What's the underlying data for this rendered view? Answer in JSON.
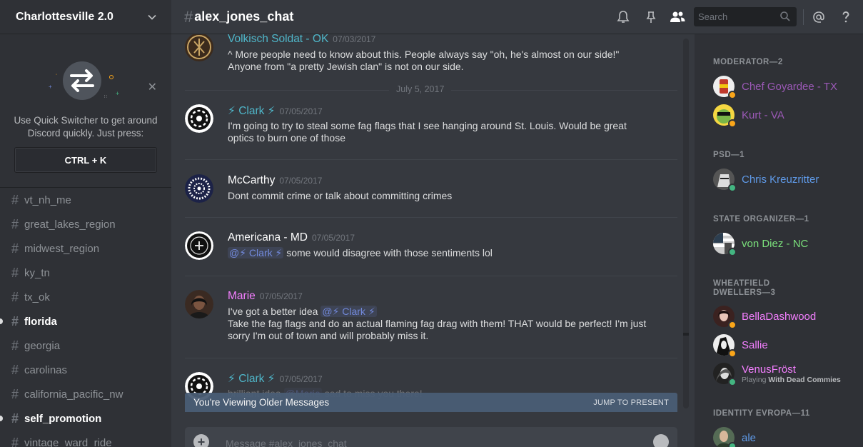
{
  "guild": {
    "name": "Charlottesville 2.0"
  },
  "quick_switcher": {
    "text": "Use Quick Switcher to get around Discord quickly. Just press:",
    "shortcut": "CTRL + K"
  },
  "channels": [
    {
      "name": "vt_nh_me",
      "unread": false
    },
    {
      "name": "great_lakes_region",
      "unread": false
    },
    {
      "name": "midwest_region",
      "unread": false
    },
    {
      "name": "ky_tn",
      "unread": false
    },
    {
      "name": "tx_ok",
      "unread": false
    },
    {
      "name": "florida",
      "unread": true
    },
    {
      "name": "georgia",
      "unread": false
    },
    {
      "name": "carolinas",
      "unread": false
    },
    {
      "name": "california_pacific_nw",
      "unread": false
    },
    {
      "name": "self_promotion",
      "unread": true
    },
    {
      "name": "vintage_ward_ride",
      "unread": false
    }
  ],
  "channel_header": {
    "hash": "#",
    "name": "alex_jones_chat"
  },
  "search": {
    "placeholder": "Search"
  },
  "messages": {
    "m0": {
      "author": "Volkisch Soldat - OK",
      "author_color": "#4fb6c9",
      "timestamp": "07/03/2017",
      "line1": "^ More people need to know about this. People always say \"oh, he's almost on our side!\"",
      "line2": "Anyone from \"a pretty Jewish clan\" is not on our side."
    },
    "date_divider": "July 5, 2017",
    "m1": {
      "author": "⚡ Clark ⚡",
      "author_color": "#4fb6c9",
      "timestamp": "07/05/2017",
      "line1": "I'm going to try to steal some fag flags that I see hanging around St. Louis. Would be great",
      "line2": "optics to burn one of those"
    },
    "m2": {
      "author": "McCarthy",
      "author_color": "#ffffff",
      "timestamp": "07/05/2017",
      "line1": "Dont commit crime or talk about committing crimes"
    },
    "m3": {
      "author": "Americana - MD",
      "author_color": "#ffffff",
      "timestamp": "07/05/2017",
      "mention": "@⚡ Clark ⚡",
      "line1": " some would disagree with those sentiments lol"
    },
    "m4": {
      "author": "Marie",
      "author_color": "#f47fff",
      "timestamp": "07/05/2017",
      "line1_pre": "I've got a better idea ",
      "mention": "@⚡ Clark ⚡",
      "line2": "Take the fag flags and do an actual flaming fag drag with them! THAT would be perfect! I'm just",
      "line3": "sorry I'm out of town and will probably miss it."
    },
    "m5": {
      "author": "⚡ Clark ⚡",
      "author_color": "#4fb6c9",
      "timestamp": "07/05/2017",
      "line1_pre": "brilliant idea ",
      "mention": "@Marie",
      "line1_post": " sad to miss you there!"
    }
  },
  "older_bar": {
    "text": "You're Viewing Older Messages",
    "jump": "JUMP TO PRESENT"
  },
  "composer": {
    "placeholder": "Message #alex_jones_chat"
  },
  "member_list": {
    "roles": [
      {
        "title": "MODERATOR—2"
      },
      {
        "title": "PSD—1"
      },
      {
        "title": "STATE ORGANIZER—1"
      },
      {
        "title_line1": "WHEATFIELD",
        "title_line2": "DWELLERS—3"
      },
      {
        "title": "IDENTITY EVROPA—11"
      }
    ],
    "members": [
      {
        "name": "Chef Goyardee - TX",
        "color": "#9b59b6",
        "status": "idle"
      },
      {
        "name": "Kurt - VA",
        "color": "#9b59b6",
        "status": "idle"
      },
      {
        "name": "Chris Kreuzritter",
        "color": "#5f9ae8",
        "status": "online"
      },
      {
        "name": "von Diez - NC",
        "color": "#7be07b",
        "status": "online"
      },
      {
        "name": "BellaDashwood",
        "color": "#f47fff",
        "status": "idle"
      },
      {
        "name": "Sallie",
        "color": "#f47fff",
        "status": "idle"
      },
      {
        "name": "VenusFröst",
        "color": "#f47fff",
        "status": "online",
        "activity_pre": "Playing ",
        "activity_game": "With Dead Commies"
      },
      {
        "name": "ale",
        "color": "#5f9ae8",
        "status": "online"
      }
    ]
  },
  "status_colors": {
    "online": "#43b581",
    "idle": "#faa61a"
  }
}
